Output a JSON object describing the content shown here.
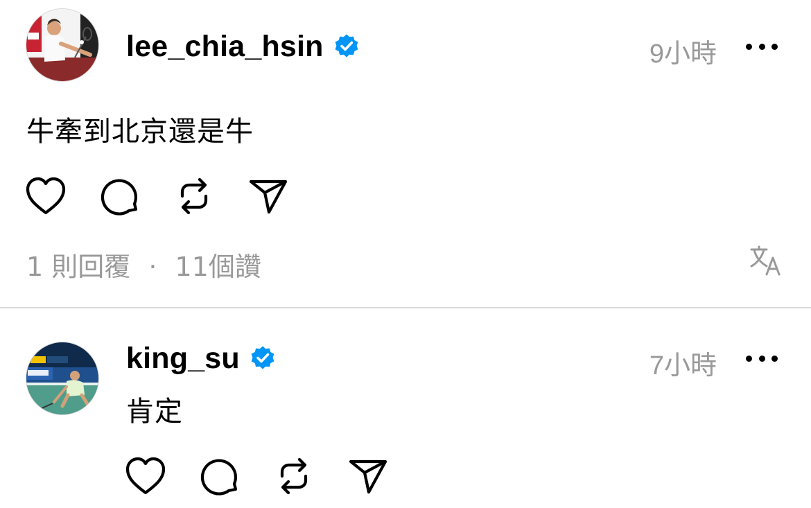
{
  "posts": [
    {
      "username": "lee_chia_hsin",
      "verified": true,
      "time": "9小時",
      "text": "牛牽到北京還是牛",
      "stats": {
        "replies": "1 則回覆",
        "separator": "·",
        "likes": "11個讚"
      },
      "actions": [
        "heart-icon",
        "comment-icon",
        "repost-icon",
        "share-icon"
      ],
      "show_translate": true
    },
    {
      "username": "king_su",
      "verified": true,
      "time": "7小時",
      "text": "肯定",
      "actions": [
        "heart-icon",
        "comment-icon",
        "repost-icon",
        "share-icon"
      ]
    }
  ],
  "colors": {
    "verified_badge": "#0095f6",
    "muted_text": "#999999",
    "divider": "#dbdbdb"
  }
}
